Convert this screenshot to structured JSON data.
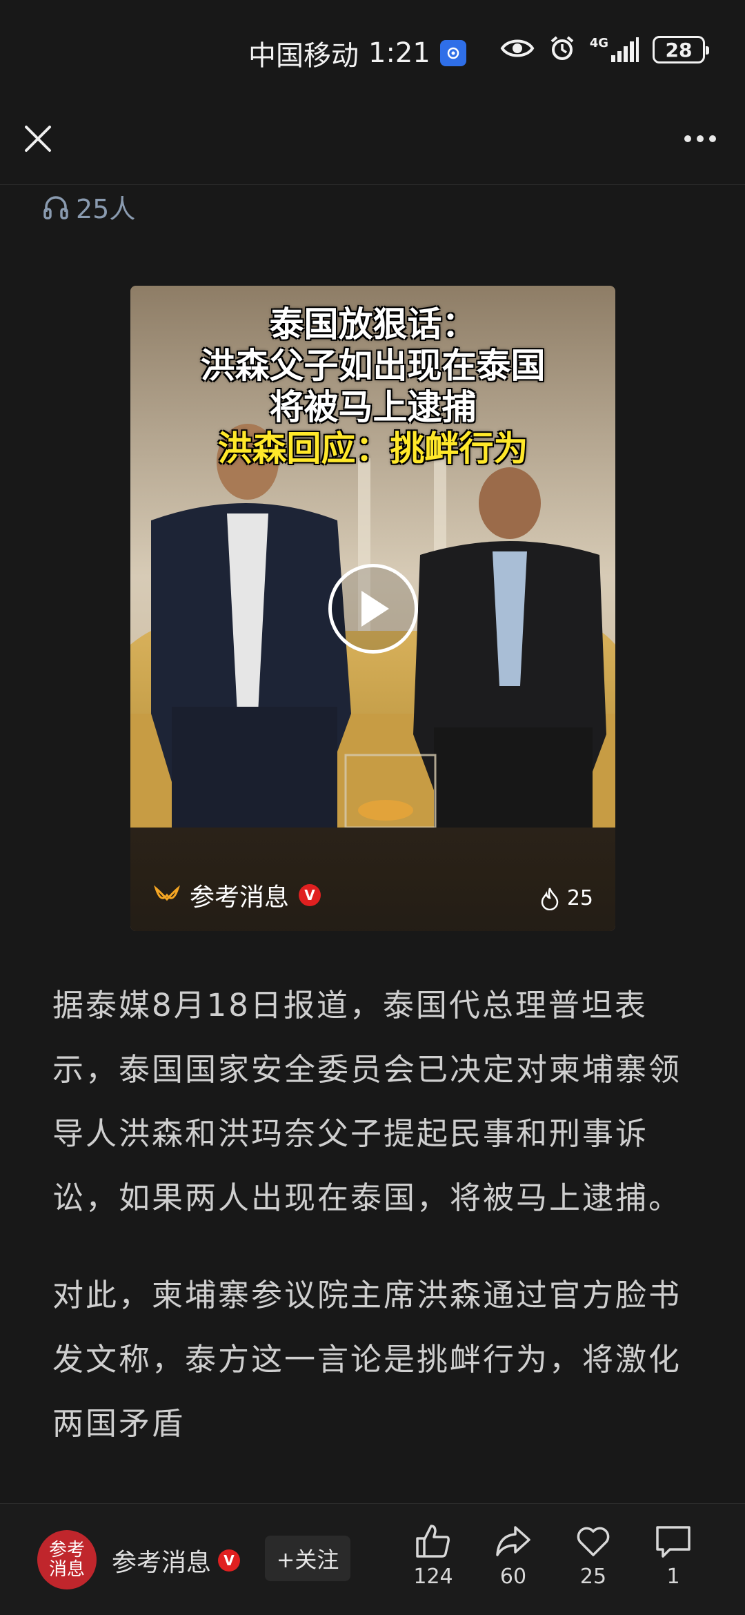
{
  "status": {
    "carrier": "中国移动",
    "time": "1:21",
    "network": "4G",
    "battery": "28"
  },
  "header": {
    "listeners": "25人"
  },
  "video": {
    "title_lines": [
      "泰国放狠话：",
      "洪森父子如出现在泰国",
      "将被马上逮捕"
    ],
    "title_highlight": "洪森回应：挑衅行为",
    "source": "参考消息",
    "verified_badge": "V",
    "heat": "25"
  },
  "article": {
    "paragraphs": [
      "据泰媒8月18日报道，泰国代总理普坦表示，泰国国家安全委员会已决定对柬埔寨领导人洪森和洪玛奈父子提起民事和刑事诉讼，如果两人出现在泰国，将被马上逮捕。",
      "对此，柬埔寨参议院主席洪森通过官方脸书发文称，泰方这一言论是挑衅行为，将激化两国矛盾"
    ]
  },
  "bottom_bar": {
    "avatar_text": "参考消息",
    "author": "参考消息",
    "verified_badge": "V",
    "follow_label": "+关注",
    "like_count": "124",
    "share_count": "60",
    "favorite_count": "25",
    "comment_count": "1"
  }
}
